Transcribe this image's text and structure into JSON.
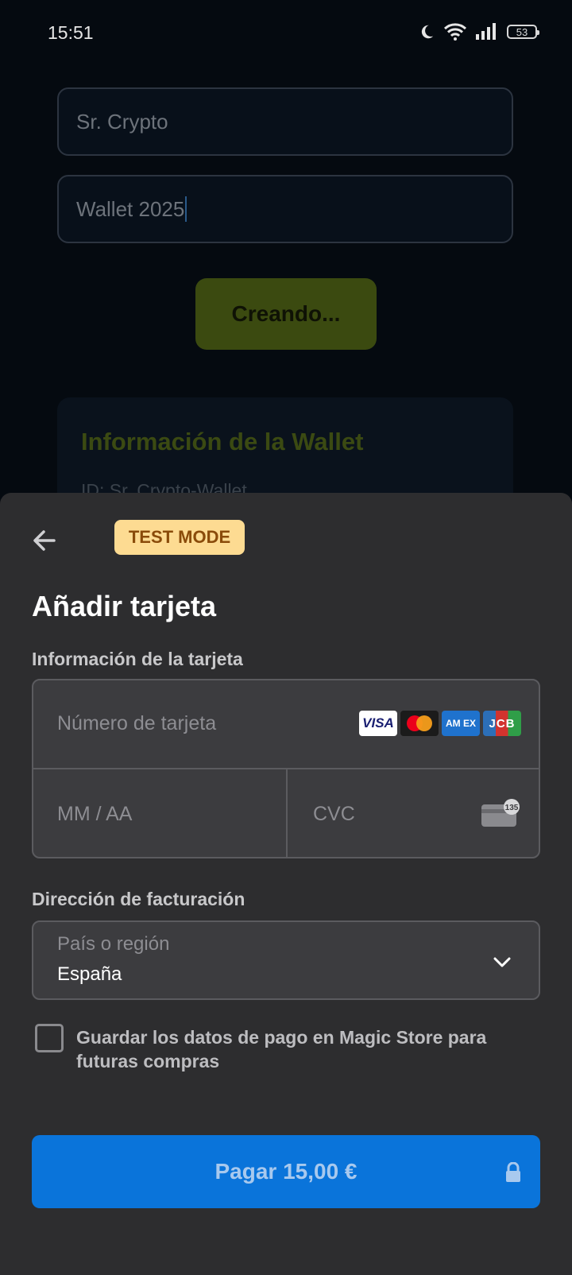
{
  "status_bar": {
    "time": "15:51",
    "battery": "53",
    "icons": [
      "moon-icon",
      "wifi-icon",
      "signal-icon",
      "battery-icon"
    ]
  },
  "background_app": {
    "name_field_value": "Sr. Crypto",
    "wallet_field_value": "Wallet 2025",
    "create_button_label": "Creando...",
    "info_card_title": "Información de la Wallet",
    "info_card_id": "ID: Sr. Crypto-Wallet"
  },
  "sheet": {
    "back_icon": "arrow-left-icon",
    "test_badge": "TEST MODE",
    "title": "Añadir tarjeta",
    "card_section_label": "Información de la tarjeta",
    "card_number_placeholder": "Número de tarjeta",
    "brands": {
      "visa": "VISA",
      "mastercard": "",
      "amex": "AM EX",
      "jcb": "JCB"
    },
    "expiry_placeholder": "MM / AA",
    "cvc_placeholder": "CVC",
    "cvc_icon_number": "135",
    "billing_section_label": "Dirección de facturación",
    "country_label": "País o región",
    "country_value": "España",
    "save_checkbox_checked": false,
    "save_label": "Guardar los datos de pago en Magic Store para futuras compras",
    "pay_button_label": "Pagar 15,00 €",
    "colors": {
      "sheet_bg": "#2d2d2f",
      "field_bg": "#3c3c3f",
      "pay_button": "#0a74da",
      "test_badge_bg": "#fddb92",
      "test_badge_text": "#8a4b0a"
    }
  }
}
